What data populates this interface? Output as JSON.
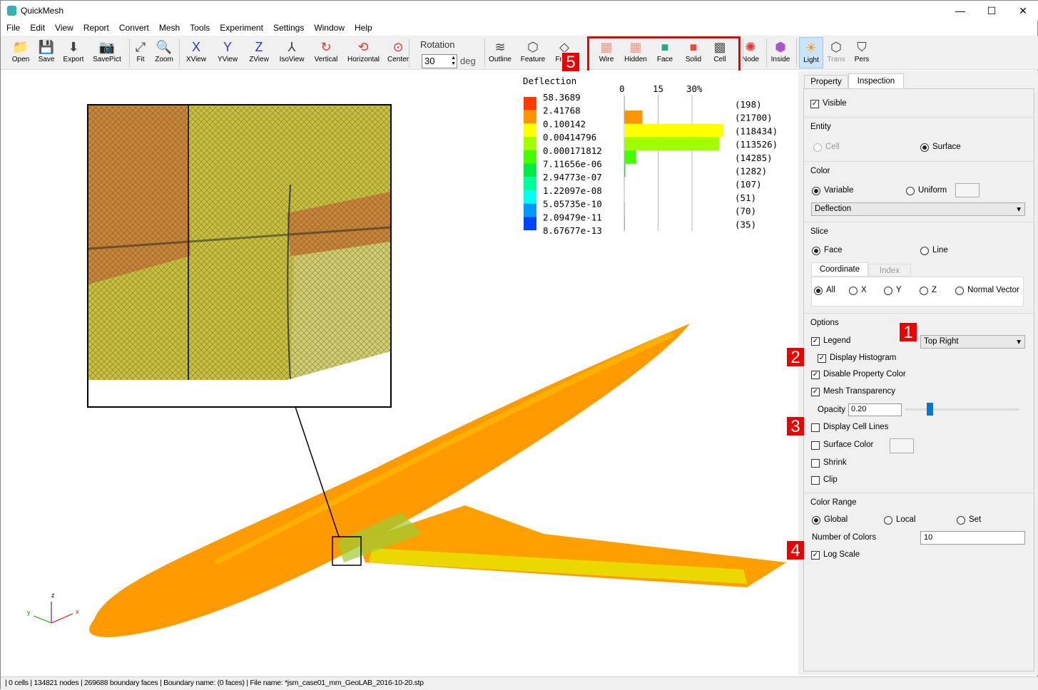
{
  "app": {
    "title": "QuickMesh"
  },
  "menu": [
    "File",
    "Edit",
    "View",
    "Report",
    "Convert",
    "Mesh",
    "Tools",
    "Experiment",
    "Settings",
    "Window",
    "Help"
  ],
  "toolbar": {
    "buttons": [
      {
        "label": "Open",
        "icon": "folder-icon"
      },
      {
        "label": "Save",
        "icon": "floppy-icon"
      },
      {
        "label": "Export",
        "icon": "download-icon"
      },
      {
        "label": "SavePict",
        "icon": "camera-icon"
      },
      {
        "label": "Fit",
        "icon": "fit-icon"
      },
      {
        "label": "Zoom",
        "icon": "zoom-icon"
      },
      {
        "label": "XView",
        "icon": "x-axis-icon"
      },
      {
        "label": "YView",
        "icon": "y-axis-icon"
      },
      {
        "label": "ZView",
        "icon": "z-axis-icon"
      },
      {
        "label": "IsoView",
        "icon": "iso-axis-icon"
      },
      {
        "label": "Vertical",
        "icon": "rotate-vertical-icon"
      },
      {
        "label": "Horizontal",
        "icon": "rotate-horizontal-icon"
      },
      {
        "label": "Center",
        "icon": "rotate-center-icon"
      },
      {
        "label": "Outline",
        "icon": "outline-icon"
      },
      {
        "label": "Feature",
        "icon": "feature-icon"
      },
      {
        "label": "Fr…e",
        "icon": "frame-icon"
      },
      {
        "label": "Wire",
        "icon": "wire-icon"
      },
      {
        "label": "Hidden",
        "icon": "hidden-icon"
      },
      {
        "label": "Face",
        "icon": "face-icon"
      },
      {
        "label": "Solid",
        "icon": "solid-icon"
      },
      {
        "label": "Cell",
        "icon": "cell-icon"
      },
      {
        "label": "Node",
        "icon": "node-icon"
      },
      {
        "label": "Inside",
        "icon": "inside-icon"
      },
      {
        "label": "Light",
        "icon": "sun-icon",
        "active": true
      },
      {
        "label": "Trans",
        "icon": "trans-icon",
        "disabled": true
      },
      {
        "label": "Pers",
        "icon": "pers-icon"
      }
    ],
    "rotation": {
      "label": "Rotation",
      "value": "30",
      "unit": "deg"
    }
  },
  "legend": {
    "title": "Deflection",
    "values": [
      "58.3689",
      "2.41768",
      "0.100142",
      "0.00414796",
      "0.000171812",
      "7.11656e-06",
      "2.94773e-07",
      "1.22097e-08",
      "5.05735e-10",
      "2.09479e-11",
      "8.67677e-13"
    ],
    "colors": [
      "#ff3a00",
      "#ff9500",
      "#ffff00",
      "#a0ff00",
      "#44ff00",
      "#00ee44",
      "#00ff99",
      "#00ffee",
      "#0099ff",
      "#0044ff"
    ],
    "axis_ticks": [
      "0",
      "15",
      "30%"
    ],
    "counts": [
      "(198)",
      "(21700)",
      "(118434)",
      "(113526)",
      "(14285)",
      "(1282)",
      "(107)",
      "(51)",
      "(70)",
      "(35)"
    ],
    "count_values": [
      198,
      21700,
      118434,
      113526,
      14285,
      1282,
      107,
      51,
      70,
      35
    ]
  },
  "axes_triad": {
    "x": "x",
    "y": "y",
    "z": "z"
  },
  "markers": [
    "1",
    "2",
    "3",
    "4",
    "5"
  ],
  "panel": {
    "tabs": [
      "Property",
      "Inspection"
    ],
    "active_tab": "Inspection",
    "visible": "Visible",
    "entity": {
      "title": "Entity",
      "cell": "Cell",
      "surface": "Surface"
    },
    "color": {
      "title": "Color",
      "variable": "Variable",
      "uniform": "Uniform",
      "variable_select": "Deflection"
    },
    "slice": {
      "title": "Slice",
      "face": "Face",
      "line": "Line",
      "subtabs": [
        "Coordinate",
        "Index"
      ],
      "all": "All",
      "x": "X",
      "y": "Y",
      "z": "Z",
      "normal": "Normal Vector"
    },
    "options": {
      "title": "Options",
      "legend": "Legend",
      "legend_pos": "Top Right",
      "histogram": "Display Histogram",
      "disable_prop": "Disable Property Color",
      "mesh_transp": "Mesh Transparency",
      "opacity_label": "Opacity",
      "opacity": "0.20",
      "cell_lines": "Display Cell Lines",
      "surface_color": "Surface Color",
      "shrink": "Shrink",
      "clip": "Clip"
    },
    "range": {
      "title": "Color Range",
      "global": "Global",
      "local": "Local",
      "set": "Set",
      "num_colors_label": "Number of Colors",
      "num_colors": "10",
      "log": "Log Scale"
    }
  },
  "status": "| 0 cells | 134821 nodes | 269688 boundary faces |  Boundary name:  (0 faces) | File name: *jsm_case01_mm_GeoLAB_2016-10-20.stp"
}
